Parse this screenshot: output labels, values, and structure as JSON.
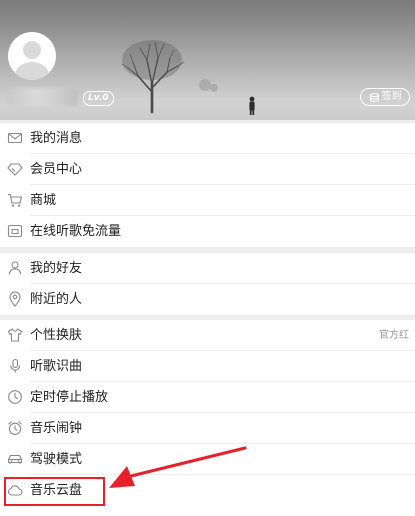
{
  "profile": {
    "level_badge": "Lv.0",
    "signin_label": "签到"
  },
  "section1": {
    "items": [
      {
        "label": "我的消息",
        "icon": "mail-icon"
      },
      {
        "label": "会员中心",
        "icon": "diamond-icon"
      },
      {
        "label": "商城",
        "icon": "cart-icon"
      },
      {
        "label": "在线听歌免流量",
        "icon": "sim-card-icon"
      }
    ]
  },
  "section2": {
    "items": [
      {
        "label": "我的好友",
        "icon": "person-icon"
      },
      {
        "label": "附近的人",
        "icon": "location-pin-icon"
      }
    ]
  },
  "section3": {
    "items": [
      {
        "label": "个性换肤",
        "icon": "tshirt-icon",
        "value": "官方红"
      },
      {
        "label": "听歌识曲",
        "icon": "microphone-icon"
      },
      {
        "label": "定时停止播放",
        "icon": "clock-icon"
      },
      {
        "label": "音乐闹钟",
        "icon": "alarm-clock-icon"
      },
      {
        "label": "驾驶模式",
        "icon": "car-icon"
      },
      {
        "label": "音乐云盘",
        "icon": "cloud-icon"
      }
    ]
  },
  "colors": {
    "annotation": "#e8202a",
    "background": "#ededed",
    "icon": "#888888"
  }
}
